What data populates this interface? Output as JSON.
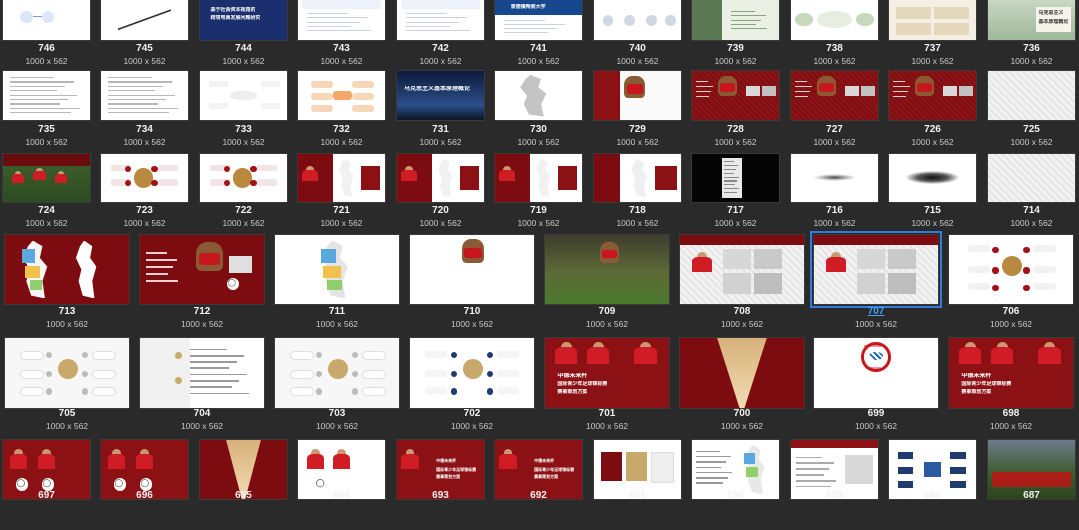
{
  "slides": [
    {
      "number": "746",
      "size": "1000 x 562",
      "theme": "white-blue-diagram",
      "texts": []
    },
    {
      "number": "745",
      "size": "1000 x 562",
      "theme": "white-line-chart",
      "texts": []
    },
    {
      "number": "744",
      "size": "1000 x 562",
      "theme": "navy-title",
      "texts": [
        "基于社会资本视角的",
        "跨境电商发展问题研究"
      ]
    },
    {
      "number": "743",
      "size": "1000 x 562",
      "theme": "white-doc",
      "texts": []
    },
    {
      "number": "742",
      "size": "1000 x 562",
      "theme": "white-doc",
      "texts": []
    },
    {
      "number": "741",
      "size": "1000 x 562",
      "theme": "white-blue-header",
      "texts": [
        "景德镇陶瓷大学"
      ]
    },
    {
      "number": "740",
      "size": "1000 x 562",
      "theme": "white-circles",
      "texts": []
    },
    {
      "number": "739",
      "size": "1000 x 562",
      "theme": "green-panel",
      "texts": []
    },
    {
      "number": "738",
      "size": "1000 x 562",
      "theme": "white-green-ovals",
      "texts": []
    },
    {
      "number": "737",
      "size": "1000 x 562",
      "theme": "beige-cards",
      "texts": []
    },
    {
      "number": "736",
      "size": "1000 x 562",
      "theme": "photo-title",
      "texts": [
        "马克思主义",
        "基本原理概论"
      ]
    },
    {
      "number": "735",
      "size": "1000 x 562",
      "theme": "white-text",
      "texts": []
    },
    {
      "number": "734",
      "size": "1000 x 562",
      "theme": "white-text",
      "texts": []
    },
    {
      "number": "733",
      "size": "1000 x 562",
      "theme": "white-mindmap",
      "texts": []
    },
    {
      "number": "732",
      "size": "1000 x 562",
      "theme": "white-orange-mindmap",
      "texts": []
    },
    {
      "number": "731",
      "size": "1000 x 562",
      "theme": "starry-title",
      "texts": [
        "马克思主义基本原理概论"
      ]
    },
    {
      "number": "730",
      "size": "1000 x 562",
      "theme": "white-map-gray",
      "texts": []
    },
    {
      "number": "729",
      "size": "1000 x 562",
      "theme": "red-mascot",
      "texts": []
    },
    {
      "number": "728",
      "size": "1000 x 562",
      "theme": "red-mascot-photos",
      "texts": []
    },
    {
      "number": "727",
      "size": "1000 x 562",
      "theme": "red-mascot-photos",
      "texts": []
    },
    {
      "number": "726",
      "size": "1000 x 562",
      "theme": "red-mascot-photos",
      "texts": []
    },
    {
      "number": "725",
      "size": "1000 x 562",
      "theme": "pattern-light",
      "texts": []
    },
    {
      "number": "724",
      "size": "1000 x 562",
      "theme": "red-team-photo",
      "texts": []
    },
    {
      "number": "723",
      "size": "1000 x 562",
      "theme": "white-red-radial",
      "texts": []
    },
    {
      "number": "722",
      "size": "1000 x 562",
      "theme": "white-red-radial",
      "texts": []
    },
    {
      "number": "721",
      "size": "1000 x 562",
      "theme": "red-player-map",
      "texts": []
    },
    {
      "number": "720",
      "size": "1000 x 562",
      "theme": "red-player-map",
      "texts": []
    },
    {
      "number": "719",
      "size": "1000 x 562",
      "theme": "red-player-map",
      "texts": []
    },
    {
      "number": "718",
      "size": "1000 x 562",
      "theme": "red-map",
      "texts": []
    },
    {
      "number": "717",
      "size": "1000 x 562",
      "theme": "black-list",
      "texts": []
    },
    {
      "number": "716",
      "size": "1000 x 562",
      "theme": "white-shadow",
      "texts": []
    },
    {
      "number": "715",
      "size": "1000 x 562",
      "theme": "white-shadow-dark",
      "texts": []
    },
    {
      "number": "714",
      "size": "1000 x 562",
      "theme": "pattern-light",
      "texts": []
    },
    {
      "number": "713",
      "size": "1000 x 562",
      "theme": "red-color-map",
      "texts": []
    },
    {
      "number": "712",
      "size": "1000 x 562",
      "theme": "red-mascot-ball",
      "texts": []
    },
    {
      "number": "711",
      "size": "1000 x 562",
      "theme": "white-color-map",
      "texts": []
    },
    {
      "number": "710",
      "size": "1000 x 562",
      "theme": "white-mascot",
      "texts": []
    },
    {
      "number": "709",
      "size": "1000 x 562",
      "theme": "stadium-mascot",
      "texts": []
    },
    {
      "number": "708",
      "size": "1000 x 562",
      "theme": "pattern-photos",
      "texts": []
    },
    {
      "number": "707",
      "size": "1000 x 562",
      "theme": "pattern-photos",
      "texts": [],
      "selected": true
    },
    {
      "number": "706",
      "size": "1000 x 562",
      "theme": "white-radial-red",
      "texts": []
    },
    {
      "number": "705",
      "size": "1000 x 562",
      "theme": "white-radial-gold",
      "texts": []
    },
    {
      "number": "704",
      "size": "1000 x 562",
      "theme": "white-text-gold",
      "texts": []
    },
    {
      "number": "703",
      "size": "1000 x 562",
      "theme": "white-radial-gold",
      "texts": []
    },
    {
      "number": "702",
      "size": "1000 x 562",
      "theme": "white-radial-navy",
      "texts": []
    },
    {
      "number": "701",
      "size": "1000 x 562",
      "theme": "red-cover",
      "texts": [
        "中德未来杯",
        "国际青少年足球锦标赛",
        "赛事策划方案"
      ]
    },
    {
      "number": "700",
      "size": "1000 x 562",
      "theme": "red-fan",
      "texts": []
    },
    {
      "number": "699",
      "size": "1000 x 562",
      "theme": "white-logo",
      "texts": [
        "FC BAYERN",
        "MÜNCHEN"
      ]
    },
    {
      "number": "698",
      "size": "1000 x 562",
      "theme": "red-cover",
      "texts": [
        "中德未来杯",
        "国际青少年足球锦标赛",
        "赛事策划方案"
      ]
    },
    {
      "number": "697",
      "size": "",
      "theme": "red-players",
      "texts": []
    },
    {
      "number": "696",
      "size": "",
      "theme": "red-players",
      "texts": []
    },
    {
      "number": "695",
      "size": "",
      "theme": "red-fan",
      "texts": []
    },
    {
      "number": "694",
      "size": "",
      "theme": "white-players",
      "texts": []
    },
    {
      "number": "693",
      "size": "",
      "theme": "red-cover-small",
      "texts": [
        "中德未来杯",
        "国际青少年足球锦标赛",
        "赛事策划方案"
      ]
    },
    {
      "number": "692",
      "size": "",
      "theme": "red-cover-small",
      "texts": [
        "中德未来杯",
        "国际青少年足球锦标赛",
        "赛事策划方案"
      ]
    },
    {
      "number": "691",
      "size": "",
      "theme": "color-swatches",
      "texts": []
    },
    {
      "number": "690",
      "size": "",
      "theme": "white-text-map",
      "texts": []
    },
    {
      "number": "689",
      "size": "",
      "theme": "white-red-header",
      "texts": []
    },
    {
      "number": "688",
      "size": "",
      "theme": "white-bracket",
      "texts": []
    },
    {
      "number": "687",
      "size": "",
      "theme": "stadium-red-text",
      "texts": []
    }
  ]
}
